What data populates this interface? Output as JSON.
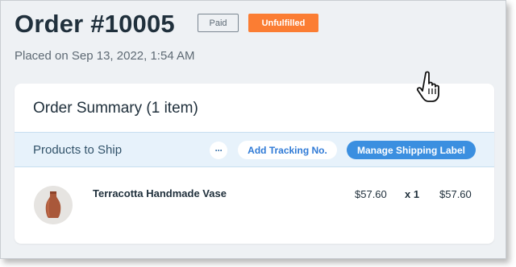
{
  "order": {
    "title": "Order #10005",
    "badge_paid": "Paid",
    "badge_unfulfilled": "Unfulfilled",
    "placed_on": "Placed on Sep 13, 2022, 1:54 AM"
  },
  "summary": {
    "title": "Order Summary (1 item)",
    "ship_section_label": "Products to Ship",
    "more_label": "···",
    "add_tracking_label": "Add Tracking No.",
    "manage_label": "Manage Shipping Label"
  },
  "product": {
    "name": "Terracotta Handmade Vase",
    "price": "$57.60",
    "quantity": "x 1",
    "total": "$57.60",
    "icon": "vase-icon"
  },
  "colors": {
    "unfulfilled": "#fb7d33",
    "primary_button": "#3b8fe0",
    "section_highlight": "#e7f2fb"
  }
}
